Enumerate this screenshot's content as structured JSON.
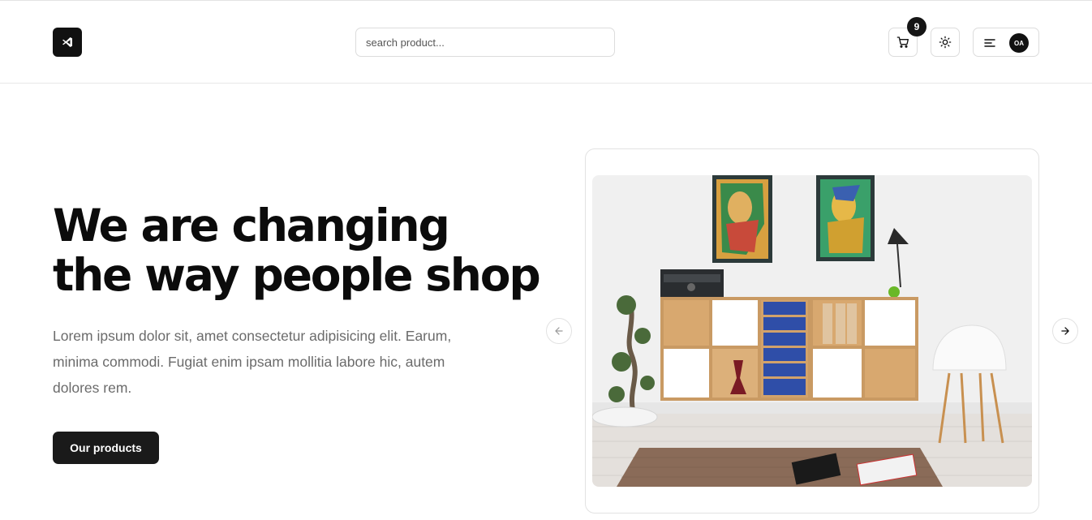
{
  "header": {
    "logo_icon": "vscode-style-logo-icon",
    "search": {
      "placeholder": "search product...",
      "value": ""
    },
    "cart": {
      "icon": "cart-icon",
      "count": "9"
    },
    "theme_toggle": {
      "icon": "sun-icon"
    },
    "menu": {
      "icon": "hamburger-icon",
      "avatar_initials": "OA"
    }
  },
  "hero": {
    "title": "We are changing the way people shop",
    "description": "Lorem ipsum dolor sit, amet consectetur adipisicing elit. Earum, minima commodi. Fugiat enim ipsam mollitia labore hic, autem dolores rem.",
    "cta_label": "Our products"
  },
  "carousel": {
    "prev_icon": "arrow-left-icon",
    "next_icon": "arrow-right-icon"
  },
  "colors": {
    "primary": "#1a1a1a",
    "muted_text": "#6b6b6b",
    "border": "#dcdcdc"
  }
}
